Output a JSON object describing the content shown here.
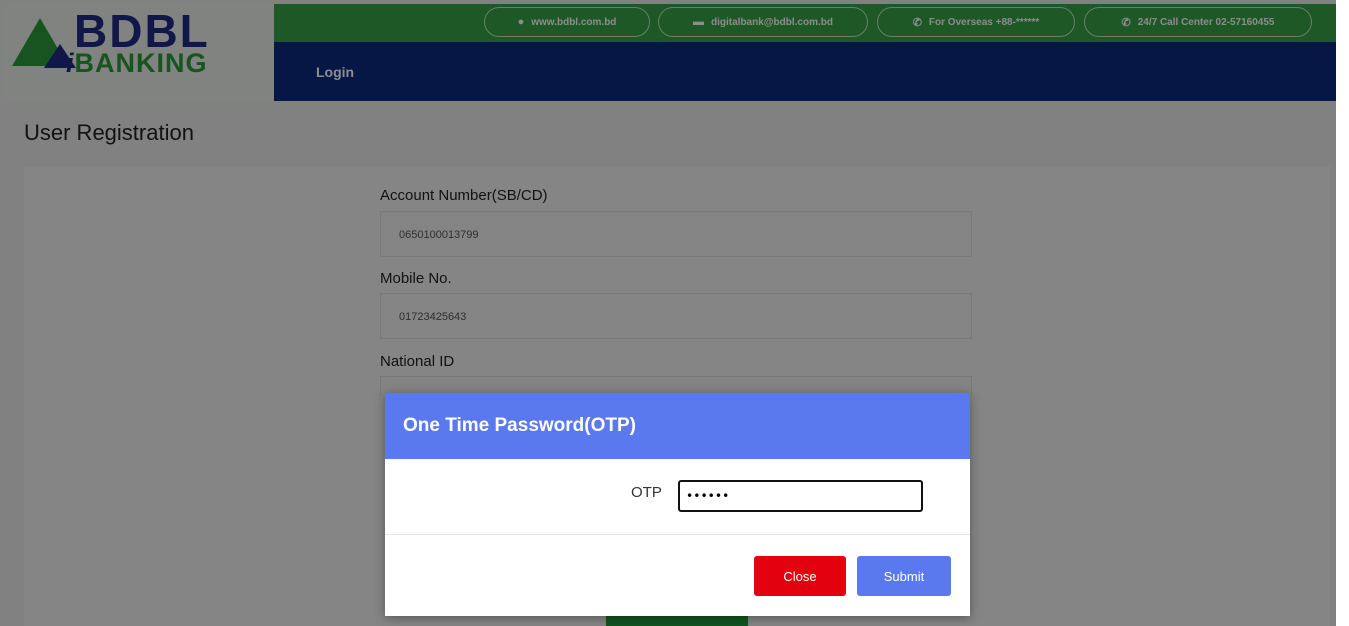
{
  "brand": {
    "logo_top": "BDBL",
    "logo_bottom_i": "i",
    "logo_bottom_rest": "BANKING",
    "primary_color": "#1f2c85",
    "accent_color": "#35a045"
  },
  "topbar": {
    "items": [
      {
        "icon": "globe-icon",
        "label": "www.bdbl.com.bd"
      },
      {
        "icon": "mail-icon",
        "label": "digitalbank@bdbl.com.bd"
      },
      {
        "icon": "phone-icon",
        "label": "For Overseas +88-******"
      },
      {
        "icon": "phone-icon",
        "label": "24/7 Call Center 02-57160455"
      }
    ]
  },
  "nav": {
    "login_label": "Login"
  },
  "page": {
    "title": "User Registration"
  },
  "form": {
    "account_label": "Account Number(SB/CD)",
    "account_value": "0650100013799",
    "mobile_label": "Mobile No.",
    "mobile_value": "01723425643",
    "nid_label": "National ID"
  },
  "modal": {
    "title": "One Time Password(OTP)",
    "otp_label": "OTP",
    "otp_value": "••••••",
    "close_label": "Close",
    "submit_label": "Submit",
    "header_color": "#5b79ee",
    "close_color": "#e3000f"
  }
}
